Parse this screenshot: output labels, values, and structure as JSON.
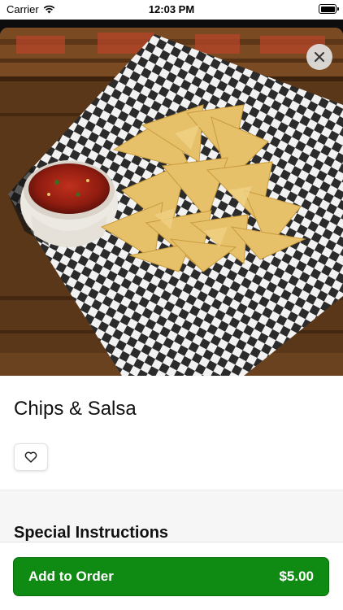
{
  "status_bar": {
    "carrier": "Carrier",
    "time": "12:03 PM"
  },
  "item": {
    "name": "Chips & Salsa",
    "image_subject": "chips-and-salsa-photo"
  },
  "sections": {
    "special_instructions_title": "Special Instructions"
  },
  "footer": {
    "add_label": "Add to Order",
    "price": "$5.00"
  },
  "icons": {
    "close": "close-icon",
    "favorite": "heart-icon",
    "wifi": "wifi-icon",
    "battery": "battery-icon"
  },
  "colors": {
    "accent": "#0f8a12",
    "accent_border": "#0a6e0d",
    "band": "#f6f6f6"
  }
}
